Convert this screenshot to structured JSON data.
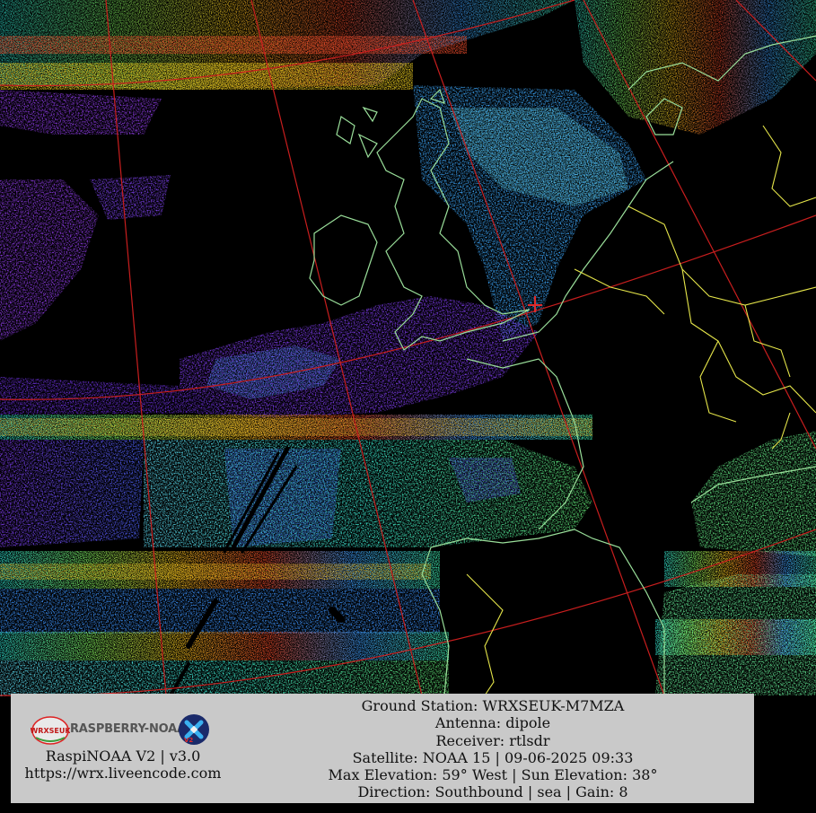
{
  "overlay": {
    "logo_badge_text": "WRXSEUK",
    "logo_text": "RASPBERRY-NOAA",
    "logo_version_tag": "V2",
    "app_version": "RaspiNOAA V2 | v3.0",
    "website": "https://wrx.liveencode.com",
    "ground_station": "Ground Station: WRXSEUK-M7MZA",
    "antenna": "Antenna: dipole",
    "receiver": "Receiver: rtlsdr",
    "satellite": "Satellite: NOAA 15 | 09-06-2025 09:33",
    "elevation": "Max Elevation: 59° West | Sun Elevation: 38°",
    "direction": "Direction: Southbound | sea | Gain: 8"
  },
  "colors": {
    "graticule": "#c81e1e",
    "coastline": "#9adf9a",
    "border": "#e6e64a",
    "station_marker": "#e02a2a",
    "panel_bg": "#c9c9c9"
  }
}
